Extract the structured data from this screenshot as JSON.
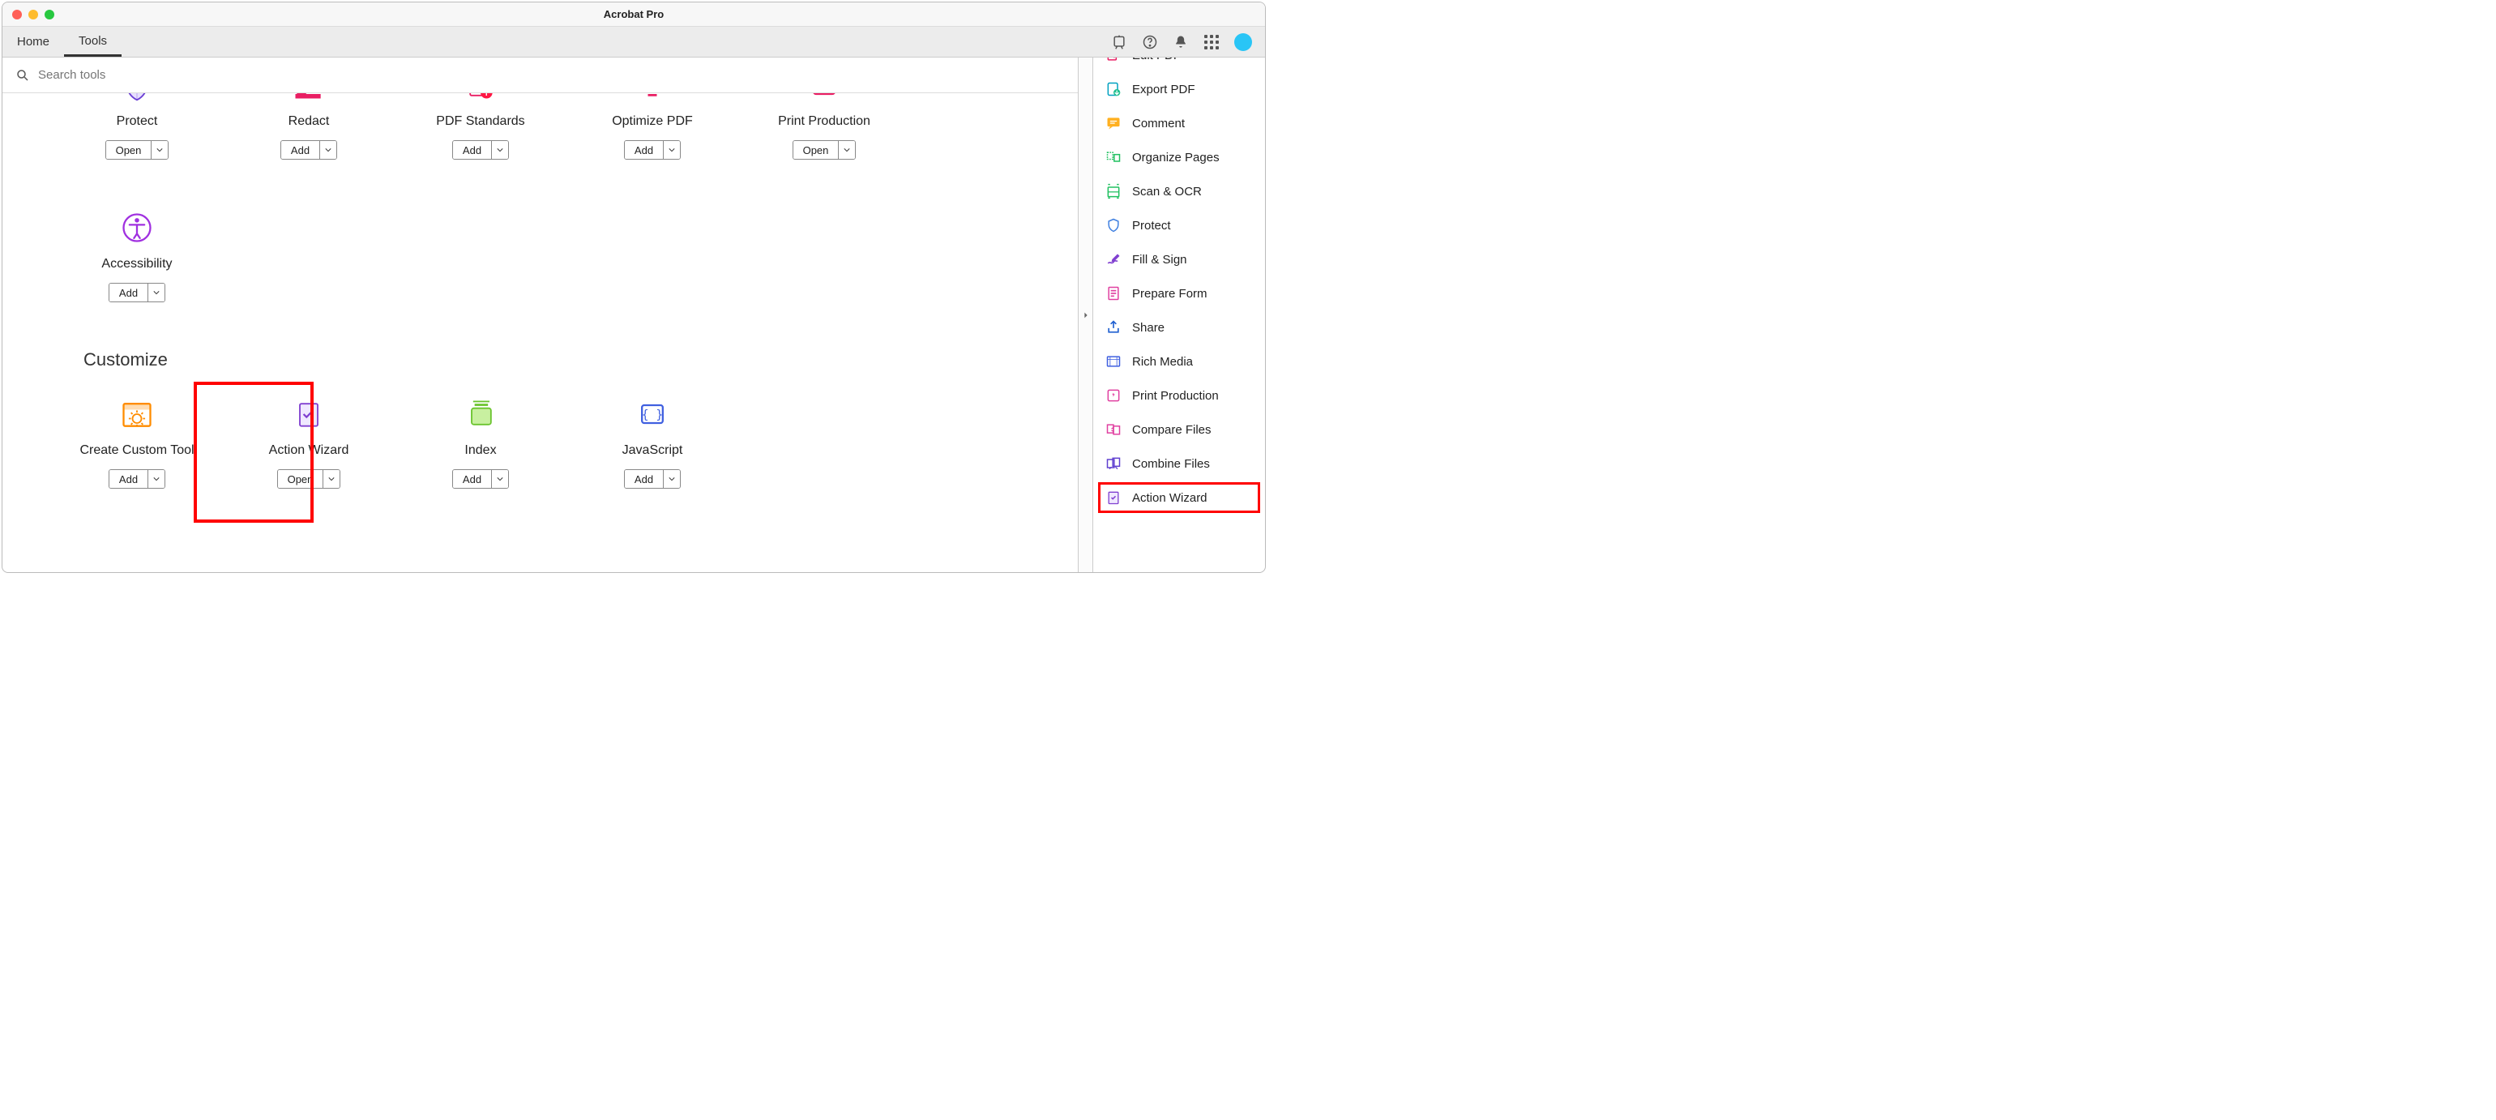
{
  "window_title": "Acrobat Pro",
  "tabs": {
    "home": "Home",
    "tools": "Tools"
  },
  "search": {
    "placeholder": "Search tools"
  },
  "buttons": {
    "open": "Open",
    "add": "Add"
  },
  "row1": [
    {
      "label": "Protect",
      "btn": "open",
      "icon": "shield"
    },
    {
      "label": "Redact",
      "btn": "add",
      "icon": "redact"
    },
    {
      "label": "PDF Standards",
      "btn": "add",
      "icon": "pdfstd"
    },
    {
      "label": "Optimize PDF",
      "btn": "add",
      "icon": "optimize"
    },
    {
      "label": "Print Production",
      "btn": "open",
      "icon": "printprod"
    }
  ],
  "row1b": [
    {
      "label": "Accessibility",
      "btn": "add",
      "icon": "accessibility"
    }
  ],
  "section_customize": "Customize",
  "row2": [
    {
      "label": "Create Custom Tool",
      "btn": "add",
      "icon": "customtool"
    },
    {
      "label": "Action Wizard",
      "btn": "open",
      "icon": "actionwizard",
      "highlight": true
    },
    {
      "label": "Index",
      "btn": "add",
      "icon": "index"
    },
    {
      "label": "JavaScript",
      "btn": "add",
      "icon": "javascript"
    }
  ],
  "panel": [
    {
      "label": "Edit PDF",
      "icon": "editpdf",
      "partial": true
    },
    {
      "label": "Export PDF",
      "icon": "exportpdf"
    },
    {
      "label": "Comment",
      "icon": "comment"
    },
    {
      "label": "Organize Pages",
      "icon": "organize"
    },
    {
      "label": "Scan & OCR",
      "icon": "scan"
    },
    {
      "label": "Protect",
      "icon": "protect"
    },
    {
      "label": "Fill & Sign",
      "icon": "fillsign"
    },
    {
      "label": "Prepare Form",
      "icon": "prepare"
    },
    {
      "label": "Share",
      "icon": "share"
    },
    {
      "label": "Rich Media",
      "icon": "richmedia"
    },
    {
      "label": "Print Production",
      "icon": "printprod2"
    },
    {
      "label": "Compare Files",
      "icon": "compare"
    },
    {
      "label": "Combine Files",
      "icon": "combine"
    },
    {
      "label": "Action Wizard",
      "icon": "actionwizard2",
      "highlight": true
    }
  ]
}
